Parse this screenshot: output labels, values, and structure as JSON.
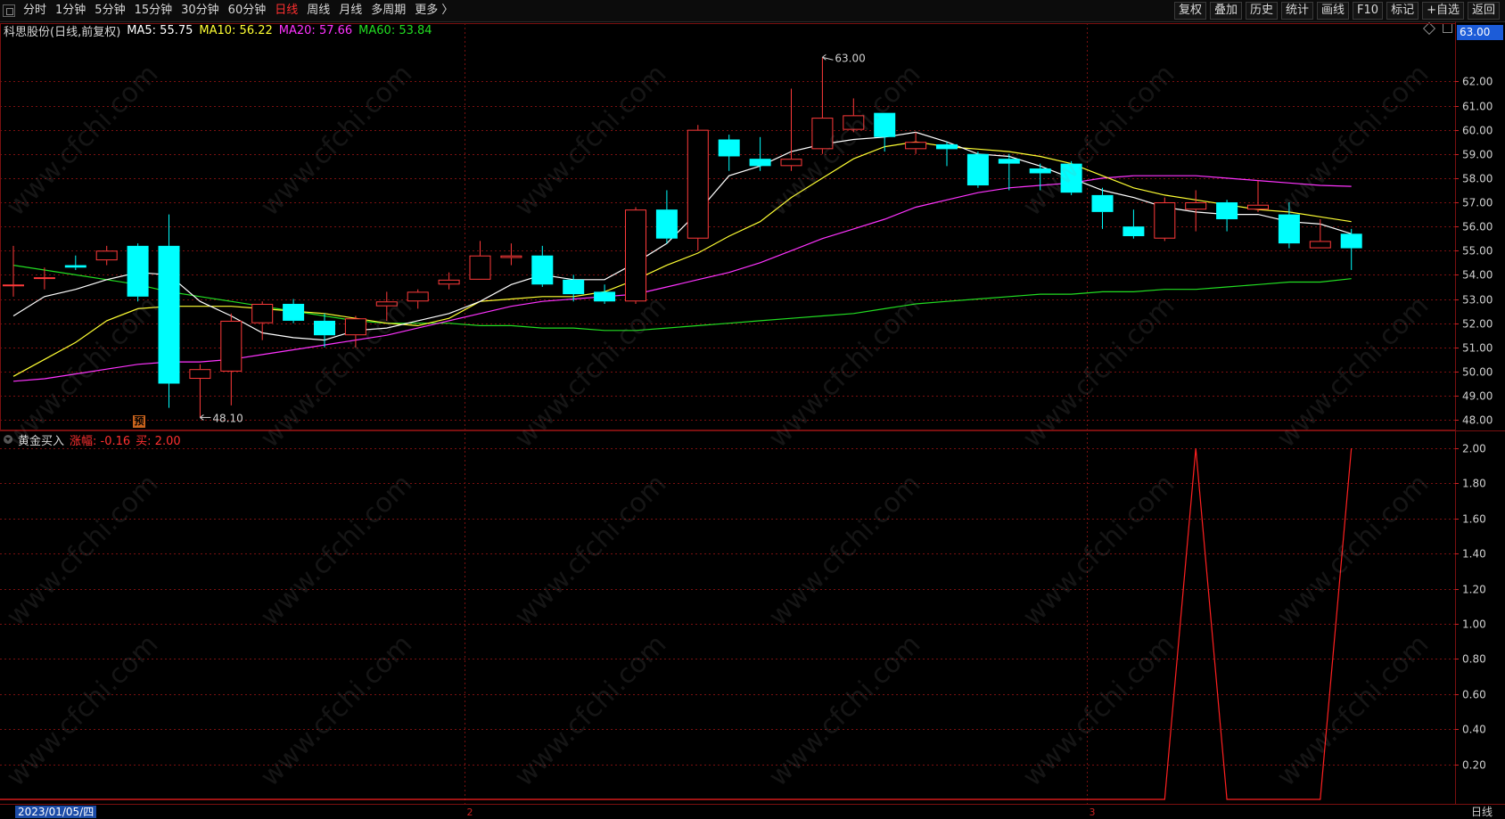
{
  "toolbar": {
    "left_items": [
      "分时",
      "1分钟",
      "5分钟",
      "15分钟",
      "30分钟",
      "60分钟",
      "日线",
      "周线",
      "月线",
      "多周期",
      "更多 〉"
    ],
    "active_item": "日线",
    "right_items": [
      "复权",
      "叠加",
      "历史",
      "统计",
      "画线",
      "F10",
      "标记",
      "+自选",
      "返回"
    ]
  },
  "legend": {
    "title": "科思股份(日线,前复权)",
    "ma5": "MA5: 55.75",
    "ma10": "MA10: 56.22",
    "ma20": "MA20: 57.66",
    "ma60": "MA60: 53.84"
  },
  "indicator_legend": {
    "name": "黄金买入",
    "change": "涨幅: -0.16",
    "buy": "买: 2.00"
  },
  "current_price_tag": "63.00",
  "presale_badge": "预",
  "watermark_text": "www.cfchi.com",
  "bottom": {
    "date_label": "2023/01/05/四",
    "period_label": "日线"
  },
  "colors": {
    "up": "#ff3a3a",
    "down": "#00ffff",
    "ma5": "#ffffff",
    "ma10": "#ffff33",
    "ma20": "#ff33ff",
    "ma60": "#22dd22",
    "grid": "#7a1010",
    "indicator": "#ff2020"
  },
  "chart_data": [
    {
      "type": "candlestick",
      "title": "科思股份(日线,前复权)",
      "y_ticks": [
        "48.00",
        "49.00",
        "50.00",
        "51.00",
        "52.00",
        "53.00",
        "54.00",
        "55.00",
        "56.00",
        "57.00",
        "58.00",
        "59.00",
        "60.00",
        "61.00",
        "62.00"
      ],
      "ylim": [
        47.6,
        63.6
      ],
      "annotations": [
        {
          "label": "63.00",
          "index": 26
        },
        {
          "label": "48.10",
          "index": 6
        }
      ],
      "month_marks": [
        {
          "label": "2",
          "index": 14
        },
        {
          "label": "3",
          "index": 34
        }
      ],
      "candles": [
        {
          "o": 53.6,
          "c": 53.6,
          "h": 55.2,
          "l": 53.1
        },
        {
          "o": 53.9,
          "c": 53.9,
          "h": 54.3,
          "l": 53.4
        },
        {
          "o": 54.4,
          "c": 54.3,
          "h": 54.8,
          "l": 54.2
        },
        {
          "o": 54.6,
          "c": 55.0,
          "h": 55.2,
          "l": 54.4
        },
        {
          "o": 55.2,
          "c": 53.1,
          "h": 55.3,
          "l": 52.9
        },
        {
          "o": 55.2,
          "c": 49.5,
          "h": 56.5,
          "l": 48.5
        },
        {
          "o": 49.7,
          "c": 50.1,
          "h": 50.3,
          "l": 48.1
        },
        {
          "o": 50.0,
          "c": 52.1,
          "h": 52.4,
          "l": 48.6
        },
        {
          "o": 52.0,
          "c": 52.8,
          "h": 52.9,
          "l": 51.3
        },
        {
          "o": 52.8,
          "c": 52.1,
          "h": 53.0,
          "l": 52.0
        },
        {
          "o": 52.1,
          "c": 51.5,
          "h": 52.4,
          "l": 51.0
        },
        {
          "o": 51.5,
          "c": 52.2,
          "h": 52.3,
          "l": 51.0
        },
        {
          "o": 52.7,
          "c": 52.9,
          "h": 53.3,
          "l": 52.1
        },
        {
          "o": 52.9,
          "c": 53.3,
          "h": 53.4,
          "l": 52.6
        },
        {
          "o": 53.6,
          "c": 53.8,
          "h": 54.1,
          "l": 53.4
        },
        {
          "o": 53.8,
          "c": 54.8,
          "h": 55.4,
          "l": 53.8
        },
        {
          "o": 54.7,
          "c": 54.8,
          "h": 55.3,
          "l": 54.4
        },
        {
          "o": 54.8,
          "c": 53.6,
          "h": 55.2,
          "l": 53.5
        },
        {
          "o": 53.8,
          "c": 53.2,
          "h": 54.0,
          "l": 52.9
        },
        {
          "o": 53.3,
          "c": 52.9,
          "h": 53.6,
          "l": 52.8
        },
        {
          "o": 52.9,
          "c": 56.7,
          "h": 56.8,
          "l": 52.8
        },
        {
          "o": 56.7,
          "c": 55.5,
          "h": 57.5,
          "l": 55.3
        },
        {
          "o": 55.5,
          "c": 60.0,
          "h": 60.2,
          "l": 55.0
        },
        {
          "o": 59.6,
          "c": 58.9,
          "h": 59.8,
          "l": 58.3
        },
        {
          "o": 58.8,
          "c": 58.5,
          "h": 59.7,
          "l": 58.3
        },
        {
          "o": 58.5,
          "c": 58.8,
          "h": 61.7,
          "l": 58.3
        },
        {
          "o": 59.2,
          "c": 60.5,
          "h": 63.0,
          "l": 59.0
        },
        {
          "o": 60.0,
          "c": 60.6,
          "h": 61.3,
          "l": 59.9
        },
        {
          "o": 60.7,
          "c": 59.7,
          "h": 60.7,
          "l": 59.1
        },
        {
          "o": 59.2,
          "c": 59.5,
          "h": 59.9,
          "l": 59.0
        },
        {
          "o": 59.4,
          "c": 59.2,
          "h": 59.5,
          "l": 58.5
        },
        {
          "o": 59.0,
          "c": 57.7,
          "h": 59.1,
          "l": 57.6
        },
        {
          "o": 58.8,
          "c": 58.6,
          "h": 59.0,
          "l": 57.5
        },
        {
          "o": 58.4,
          "c": 58.2,
          "h": 58.6,
          "l": 57.5
        },
        {
          "o": 58.6,
          "c": 57.4,
          "h": 58.7,
          "l": 57.3
        },
        {
          "o": 57.3,
          "c": 56.6,
          "h": 57.6,
          "l": 55.9
        },
        {
          "o": 56.0,
          "c": 55.6,
          "h": 56.7,
          "l": 55.5
        },
        {
          "o": 55.5,
          "c": 57.0,
          "h": 57.2,
          "l": 55.4
        },
        {
          "o": 56.7,
          "c": 57.0,
          "h": 57.5,
          "l": 55.8
        },
        {
          "o": 57.0,
          "c": 56.3,
          "h": 57.1,
          "l": 55.8
        },
        {
          "o": 56.7,
          "c": 56.9,
          "h": 57.9,
          "l": 56.6
        },
        {
          "o": 56.5,
          "c": 55.3,
          "h": 57.0,
          "l": 55.1
        },
        {
          "o": 55.1,
          "c": 55.4,
          "h": 56.3,
          "l": 55.1
        },
        {
          "o": 55.7,
          "c": 55.1,
          "h": 55.9,
          "l": 54.2
        }
      ],
      "ma5": [
        52.3,
        53.1,
        53.4,
        53.8,
        54.1,
        54.0,
        52.9,
        52.3,
        51.6,
        51.4,
        51.3,
        51.7,
        51.8,
        52.1,
        52.4,
        52.9,
        53.6,
        54.0,
        53.8,
        53.8,
        54.5,
        55.3,
        56.6,
        58.1,
        58.5,
        59.1,
        59.4,
        59.6,
        59.7,
        59.9,
        59.5,
        59.0,
        58.9,
        58.5,
        58.0,
        57.5,
        57.2,
        56.8,
        56.6,
        56.5,
        56.5,
        56.2,
        56.1,
        55.7
      ],
      "ma10": [
        49.8,
        50.5,
        51.2,
        52.1,
        52.6,
        52.7,
        52.7,
        52.7,
        52.6,
        52.5,
        52.4,
        52.2,
        52.0,
        51.9,
        52.2,
        52.9,
        53.0,
        53.1,
        53.1,
        53.3,
        53.8,
        54.4,
        54.9,
        55.6,
        56.2,
        57.2,
        58.0,
        58.8,
        59.3,
        59.5,
        59.3,
        59.2,
        59.1,
        58.9,
        58.6,
        58.1,
        57.6,
        57.3,
        57.1,
        56.9,
        56.7,
        56.6,
        56.4,
        56.2
      ],
      "ma20": [
        49.6,
        49.7,
        49.9,
        50.1,
        50.3,
        50.4,
        50.4,
        50.5,
        50.7,
        50.9,
        51.1,
        51.3,
        51.5,
        51.8,
        52.1,
        52.4,
        52.7,
        52.9,
        53.0,
        53.1,
        53.2,
        53.5,
        53.8,
        54.1,
        54.5,
        55.0,
        55.5,
        55.9,
        56.3,
        56.8,
        57.1,
        57.4,
        57.6,
        57.7,
        57.8,
        58.0,
        58.1,
        58.1,
        58.1,
        58.0,
        57.9,
        57.8,
        57.7,
        57.66
      ],
      "ma60": [
        54.4,
        54.2,
        54.0,
        53.8,
        53.6,
        53.3,
        53.1,
        52.9,
        52.7,
        52.5,
        52.3,
        52.1,
        52.0,
        52.0,
        52.0,
        51.9,
        51.9,
        51.8,
        51.8,
        51.7,
        51.7,
        51.8,
        51.9,
        52.0,
        52.1,
        52.2,
        52.3,
        52.4,
        52.6,
        52.8,
        52.9,
        53.0,
        53.1,
        53.2,
        53.2,
        53.3,
        53.3,
        53.4,
        53.4,
        53.5,
        53.6,
        53.7,
        53.7,
        53.84
      ]
    },
    {
      "type": "line",
      "title": "黄金买入",
      "y_ticks": [
        "0.20",
        "0.40",
        "0.60",
        "0.80",
        "1.00",
        "1.20",
        "1.40",
        "1.60",
        "1.80",
        "2.00"
      ],
      "ylim": [
        0,
        2.0
      ],
      "series": [
        {
          "name": "买",
          "values": [
            0,
            0,
            0,
            0,
            0,
            0,
            0,
            0,
            0,
            0,
            0,
            0,
            0,
            0,
            0,
            0,
            0,
            0,
            0,
            0,
            0,
            0,
            0,
            0,
            0,
            0,
            0,
            0,
            0,
            0,
            0,
            0,
            0,
            0,
            0,
            0,
            0,
            0,
            2,
            0,
            0,
            0,
            0,
            2
          ]
        }
      ]
    }
  ]
}
